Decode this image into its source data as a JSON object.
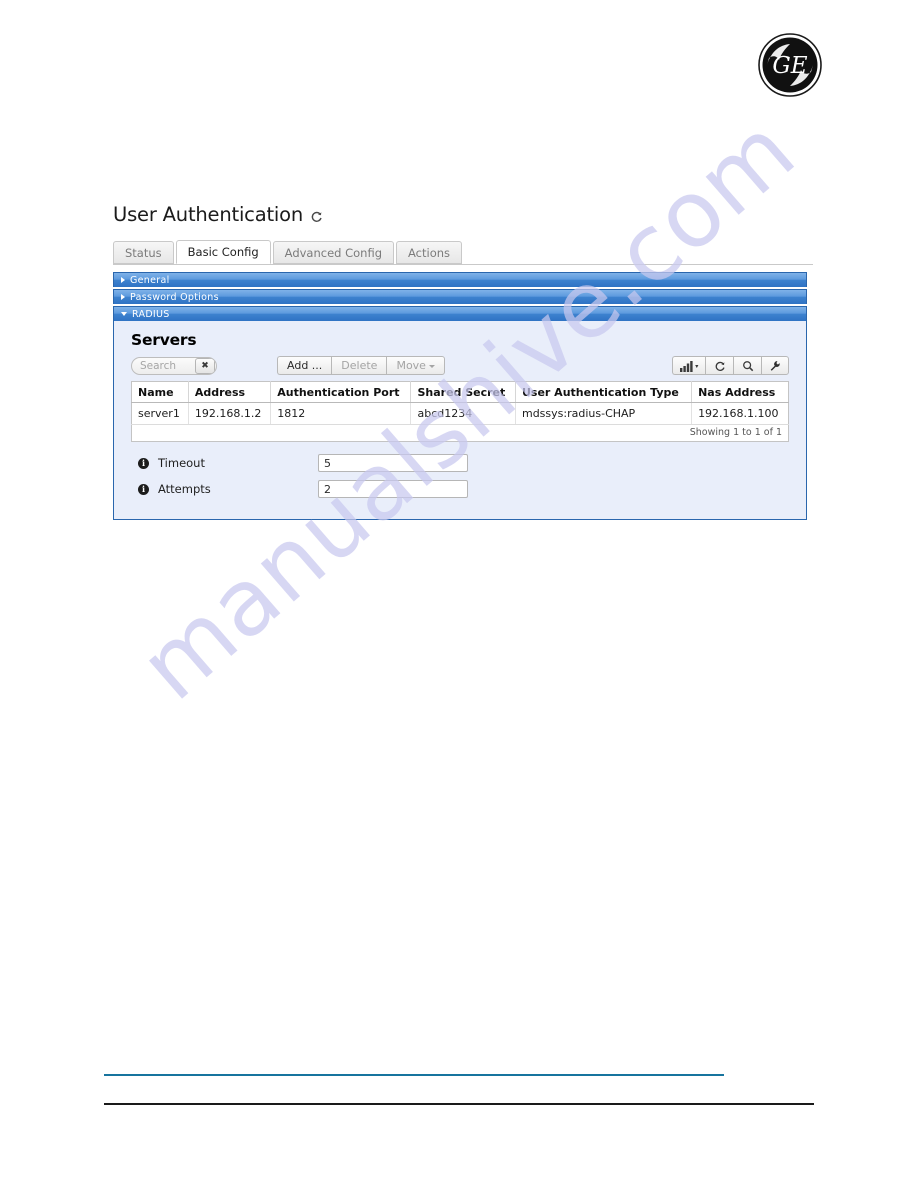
{
  "branding": {
    "logo_name": "ge-monogram-logo",
    "logo_text": "GE"
  },
  "header": {
    "title": "User Authentication",
    "refresh_icon": "refresh-icon"
  },
  "tabs": [
    {
      "label": "Status",
      "active": false
    },
    {
      "label": "Basic Config",
      "active": true
    },
    {
      "label": "Advanced Config",
      "active": false
    },
    {
      "label": "Actions",
      "active": false
    }
  ],
  "accordion": [
    {
      "label": "General",
      "expanded": false
    },
    {
      "label": "Password Options",
      "expanded": false
    },
    {
      "label": "RADIUS",
      "expanded": true
    }
  ],
  "radius": {
    "panel_heading": "Servers",
    "search": {
      "placeholder": "Search",
      "value": "",
      "clear_label": "✖"
    },
    "buttons": [
      {
        "label": "Add ...",
        "disabled": false,
        "caret": false
      },
      {
        "label": "Delete",
        "disabled": true,
        "caret": false
      },
      {
        "label": "Move",
        "disabled": true,
        "caret": true
      }
    ],
    "icon_buttons": [
      {
        "name": "chart-bars-icon",
        "caret": true
      },
      {
        "name": "refresh-icon",
        "caret": false
      },
      {
        "name": "search-icon",
        "caret": false
      },
      {
        "name": "wrench-icon",
        "caret": false
      }
    ],
    "table": {
      "columns": [
        "Name",
        "Address",
        "Authentication Port",
        "Shared Secret",
        "User Authentication Type",
        "Nas Address"
      ],
      "rows": [
        {
          "name": "server1",
          "address": "192.168.1.2",
          "authentication_port": "1812",
          "shared_secret": "abcd1234",
          "user_authentication_type": "mdssys:radius-CHAP",
          "nas_address": "192.168.1.100"
        }
      ],
      "footer": "Showing 1 to 1 of 1"
    },
    "fields": [
      {
        "label": "Timeout",
        "value": "5",
        "info_icon": "info-icon"
      },
      {
        "label": "Attempts",
        "value": "2",
        "info_icon": "info-icon"
      }
    ]
  },
  "watermark": {
    "text": "manualshive.com"
  },
  "colors": {
    "accent_blue": "#3d82cf",
    "panel_bg": "#e9eefa",
    "border_blue": "#2a66ad",
    "footer_teal": "#17749e"
  }
}
